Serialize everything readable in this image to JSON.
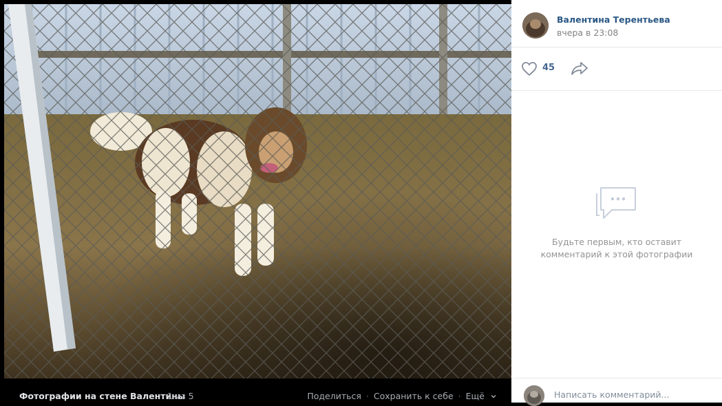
{
  "photo": {
    "album_label": "Фотографии на стене Валентины",
    "counter": "1 из 5",
    "actions": {
      "share": "Поделиться",
      "save": "Сохранить к себе",
      "more": "Ещё",
      "separator": "·"
    }
  },
  "author": {
    "name": "Валентина Терентьева",
    "time": "вчера в 23:08"
  },
  "likes": {
    "count": "45",
    "icon": "heart-icon",
    "share_icon": "share-arrow-icon"
  },
  "comments": {
    "empty_text_line1": "Будьте первым, кто оставит",
    "empty_text_line2": "комментарий к этой фотографии",
    "placeholder": "Написать комментарий..."
  },
  "colors": {
    "link": "#2a5885",
    "muted": "#828282",
    "background": "#000000",
    "panel": "#ffffff"
  }
}
